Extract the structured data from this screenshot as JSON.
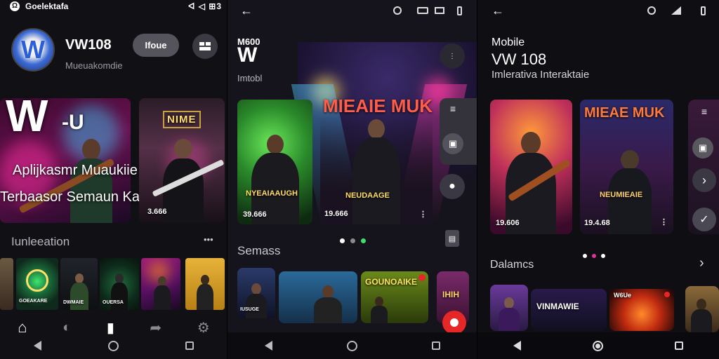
{
  "colors": {
    "accent_magenta": "#e0319a",
    "accent_cyan": "#27c9e8",
    "accent_orange": "#ff8c1a",
    "accent_green": "#3de06b",
    "notification_red": "#e52727"
  },
  "screen1": {
    "status": {
      "app_name": "Goelektafa",
      "right_icons": "ᐊ ◁ ⊞3"
    },
    "profile": {
      "avatar_letter": "W",
      "name": "VW108",
      "subtitle": "Mueuakomdie",
      "button_label": "Ifoue"
    },
    "hero": {
      "logo_text": "W",
      "logo_suffix": "-U",
      "line1": "Aplijkasmr Muaukiie",
      "line2": "Terbaasor Semaun Kahnag",
      "side_poster_title": "NIME",
      "side_poster_count": "3.666"
    },
    "section": {
      "title": "Iunleeation",
      "more": "•••"
    },
    "thumbs": [
      {
        "label": "GOEAKARE"
      },
      {
        "label": "DWMAIE"
      },
      {
        "label": "OUERSA"
      },
      {
        "label": ""
      },
      {
        "label": ""
      }
    ],
    "tabs": [
      {
        "icon": "home-icon",
        "glyph": "⌂"
      },
      {
        "icon": "disc-icon",
        "glyph": "◐"
      },
      {
        "icon": "book-icon",
        "glyph": "▮"
      },
      {
        "icon": "share-icon",
        "glyph": "➦"
      },
      {
        "icon": "settings-icon",
        "glyph": "⚙"
      }
    ]
  },
  "screen2": {
    "header": {
      "logo_top": "M600",
      "logo_big": "W",
      "subtitle": "Imtobl"
    },
    "hero_poster_title": "MIEAIE MUK",
    "left_card": {
      "title": "NYEAIAAUGH",
      "count": "39.666"
    },
    "center_card": {
      "title": "NEUDAAGE",
      "count": "19.666"
    },
    "carousel_dots": 3,
    "section": {
      "title": "Semass"
    },
    "tiles": [
      {
        "label": "IUSUGE"
      },
      {
        "label": ""
      },
      {
        "label": "GOUNOAIKE"
      },
      {
        "label": "IHIH"
      }
    ]
  },
  "screen3": {
    "header": {
      "line1": "Mobile",
      "line2": "VW 108",
      "line3": "Imlerativa Interaktaie"
    },
    "right_card": {
      "title": "MIEAE MUK",
      "subtitle": "NEUMIEAIE",
      "count": "19.4.68"
    },
    "left_card": {
      "count": "19.606"
    },
    "section": {
      "title": "Dalamcs",
      "arrow": "›"
    },
    "tiles": [
      {
        "label": ""
      },
      {
        "label": "VINMAWIE"
      },
      {
        "label": "W6Ue"
      },
      {
        "label": ""
      }
    ]
  }
}
